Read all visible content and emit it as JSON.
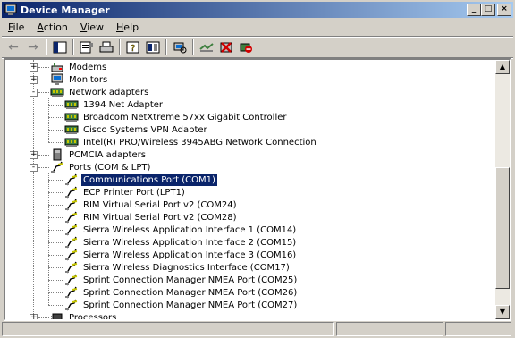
{
  "window": {
    "title": "Device Manager",
    "minimize_label": "_",
    "maximize_label": "□",
    "close_label": "×"
  },
  "menu": [
    {
      "label_rest": "ile",
      "accel": "F"
    },
    {
      "label_rest": "ction",
      "accel": "A"
    },
    {
      "label_rest": "iew",
      "accel": "V"
    },
    {
      "label_rest": "elp",
      "accel": "H"
    }
  ],
  "toolbar": {
    "back_label": "←",
    "forward_label": "→"
  },
  "tree": [
    {
      "label": "Modems",
      "icon": "modem-icon",
      "expander": "+",
      "level": 1
    },
    {
      "label": "Monitors",
      "icon": "monitor-icon",
      "expander": "+",
      "level": 1
    },
    {
      "label": "Network adapters",
      "icon": "network-adapter-icon",
      "expander": "-",
      "level": 1
    },
    {
      "label": "1394 Net Adapter",
      "icon": "network-adapter-icon",
      "level": 2
    },
    {
      "label": "Broadcom NetXtreme 57xx Gigabit Controller",
      "icon": "network-adapter-icon",
      "level": 2
    },
    {
      "label": "Cisco Systems VPN Adapter",
      "icon": "network-adapter-icon",
      "level": 2
    },
    {
      "label": "Intel(R) PRO/Wireless 3945ABG Network Connection",
      "icon": "network-adapter-icon",
      "level": 2
    },
    {
      "label": "PCMCIA adapters",
      "icon": "pcmcia-icon",
      "expander": "+",
      "level": 1
    },
    {
      "label": "Ports (COM & LPT)",
      "icon": "port-icon",
      "expander": "-",
      "level": 1
    },
    {
      "label": "Communications Port (COM1)",
      "icon": "port-icon",
      "level": 2,
      "selected": true
    },
    {
      "label": "ECP Printer Port (LPT1)",
      "icon": "port-icon",
      "level": 2
    },
    {
      "label": "RIM Virtual Serial Port v2 (COM24)",
      "icon": "port-icon",
      "level": 2
    },
    {
      "label": "RIM Virtual Serial Port v2 (COM28)",
      "icon": "port-icon",
      "level": 2
    },
    {
      "label": "Sierra Wireless Application Interface 1 (COM14)",
      "icon": "port-icon",
      "level": 2
    },
    {
      "label": "Sierra Wireless Application Interface 2 (COM15)",
      "icon": "port-icon",
      "level": 2
    },
    {
      "label": "Sierra Wireless Application Interface 3 (COM16)",
      "icon": "port-icon",
      "level": 2
    },
    {
      "label": "Sierra Wireless Diagnostics Interface (COM17)",
      "icon": "port-icon",
      "level": 2
    },
    {
      "label": "Sprint Connection Manager NMEA Port (COM25)",
      "icon": "port-icon",
      "level": 2
    },
    {
      "label": "Sprint Connection Manager NMEA Port (COM26)",
      "icon": "port-icon",
      "level": 2
    },
    {
      "label": "Sprint Connection Manager NMEA Port (COM27)",
      "icon": "port-icon",
      "level": 2
    },
    {
      "label": "Processors",
      "icon": "processor-icon",
      "expander": "+",
      "level": 1
    }
  ],
  "scrollbar": {
    "up_label": "▲",
    "down_label": "▼"
  },
  "colors": {
    "title_start": "#0a246a",
    "title_end": "#a6caf0",
    "selection": "#0a246a",
    "face": "#d4d0c8"
  }
}
